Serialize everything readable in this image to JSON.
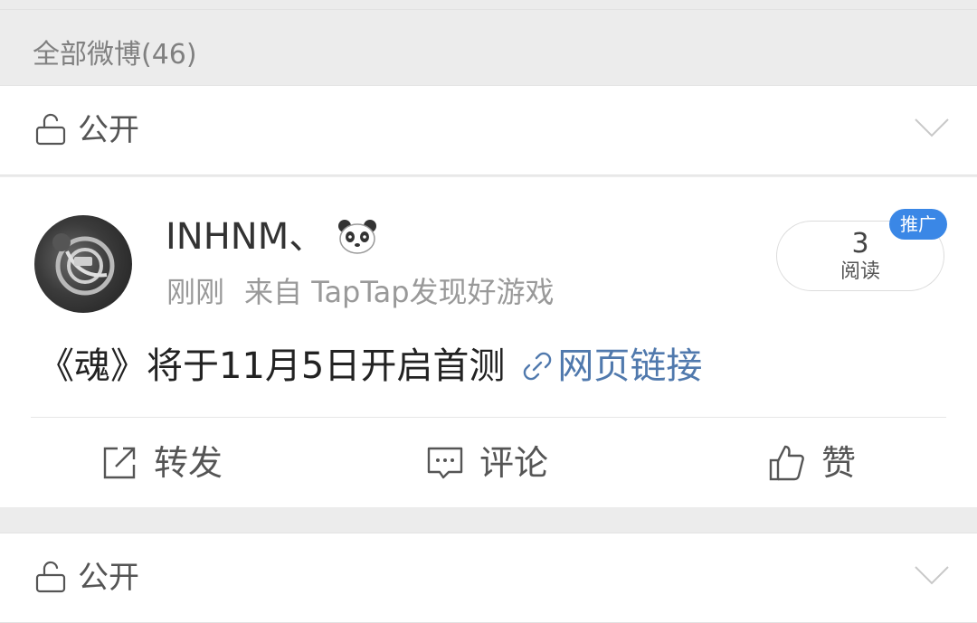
{
  "header": {
    "title": "全部微博(46)"
  },
  "privacy": {
    "label": "公开",
    "label2": "公开"
  },
  "post": {
    "author": "INHNM、",
    "badge_icon": "panda-icon",
    "time": "刚刚",
    "source": "来自 TapTap发现好游戏",
    "read_count": "3",
    "read_label": "阅读",
    "promo_label": "推广",
    "text": "《魂》将于11月5日开启首测",
    "link_text": "网页链接"
  },
  "actions": {
    "repost": "转发",
    "comment": "评论",
    "like": "赞"
  },
  "colors": {
    "link": "#5079ad",
    "promo": "#3a87e6",
    "background": "#ececec"
  }
}
